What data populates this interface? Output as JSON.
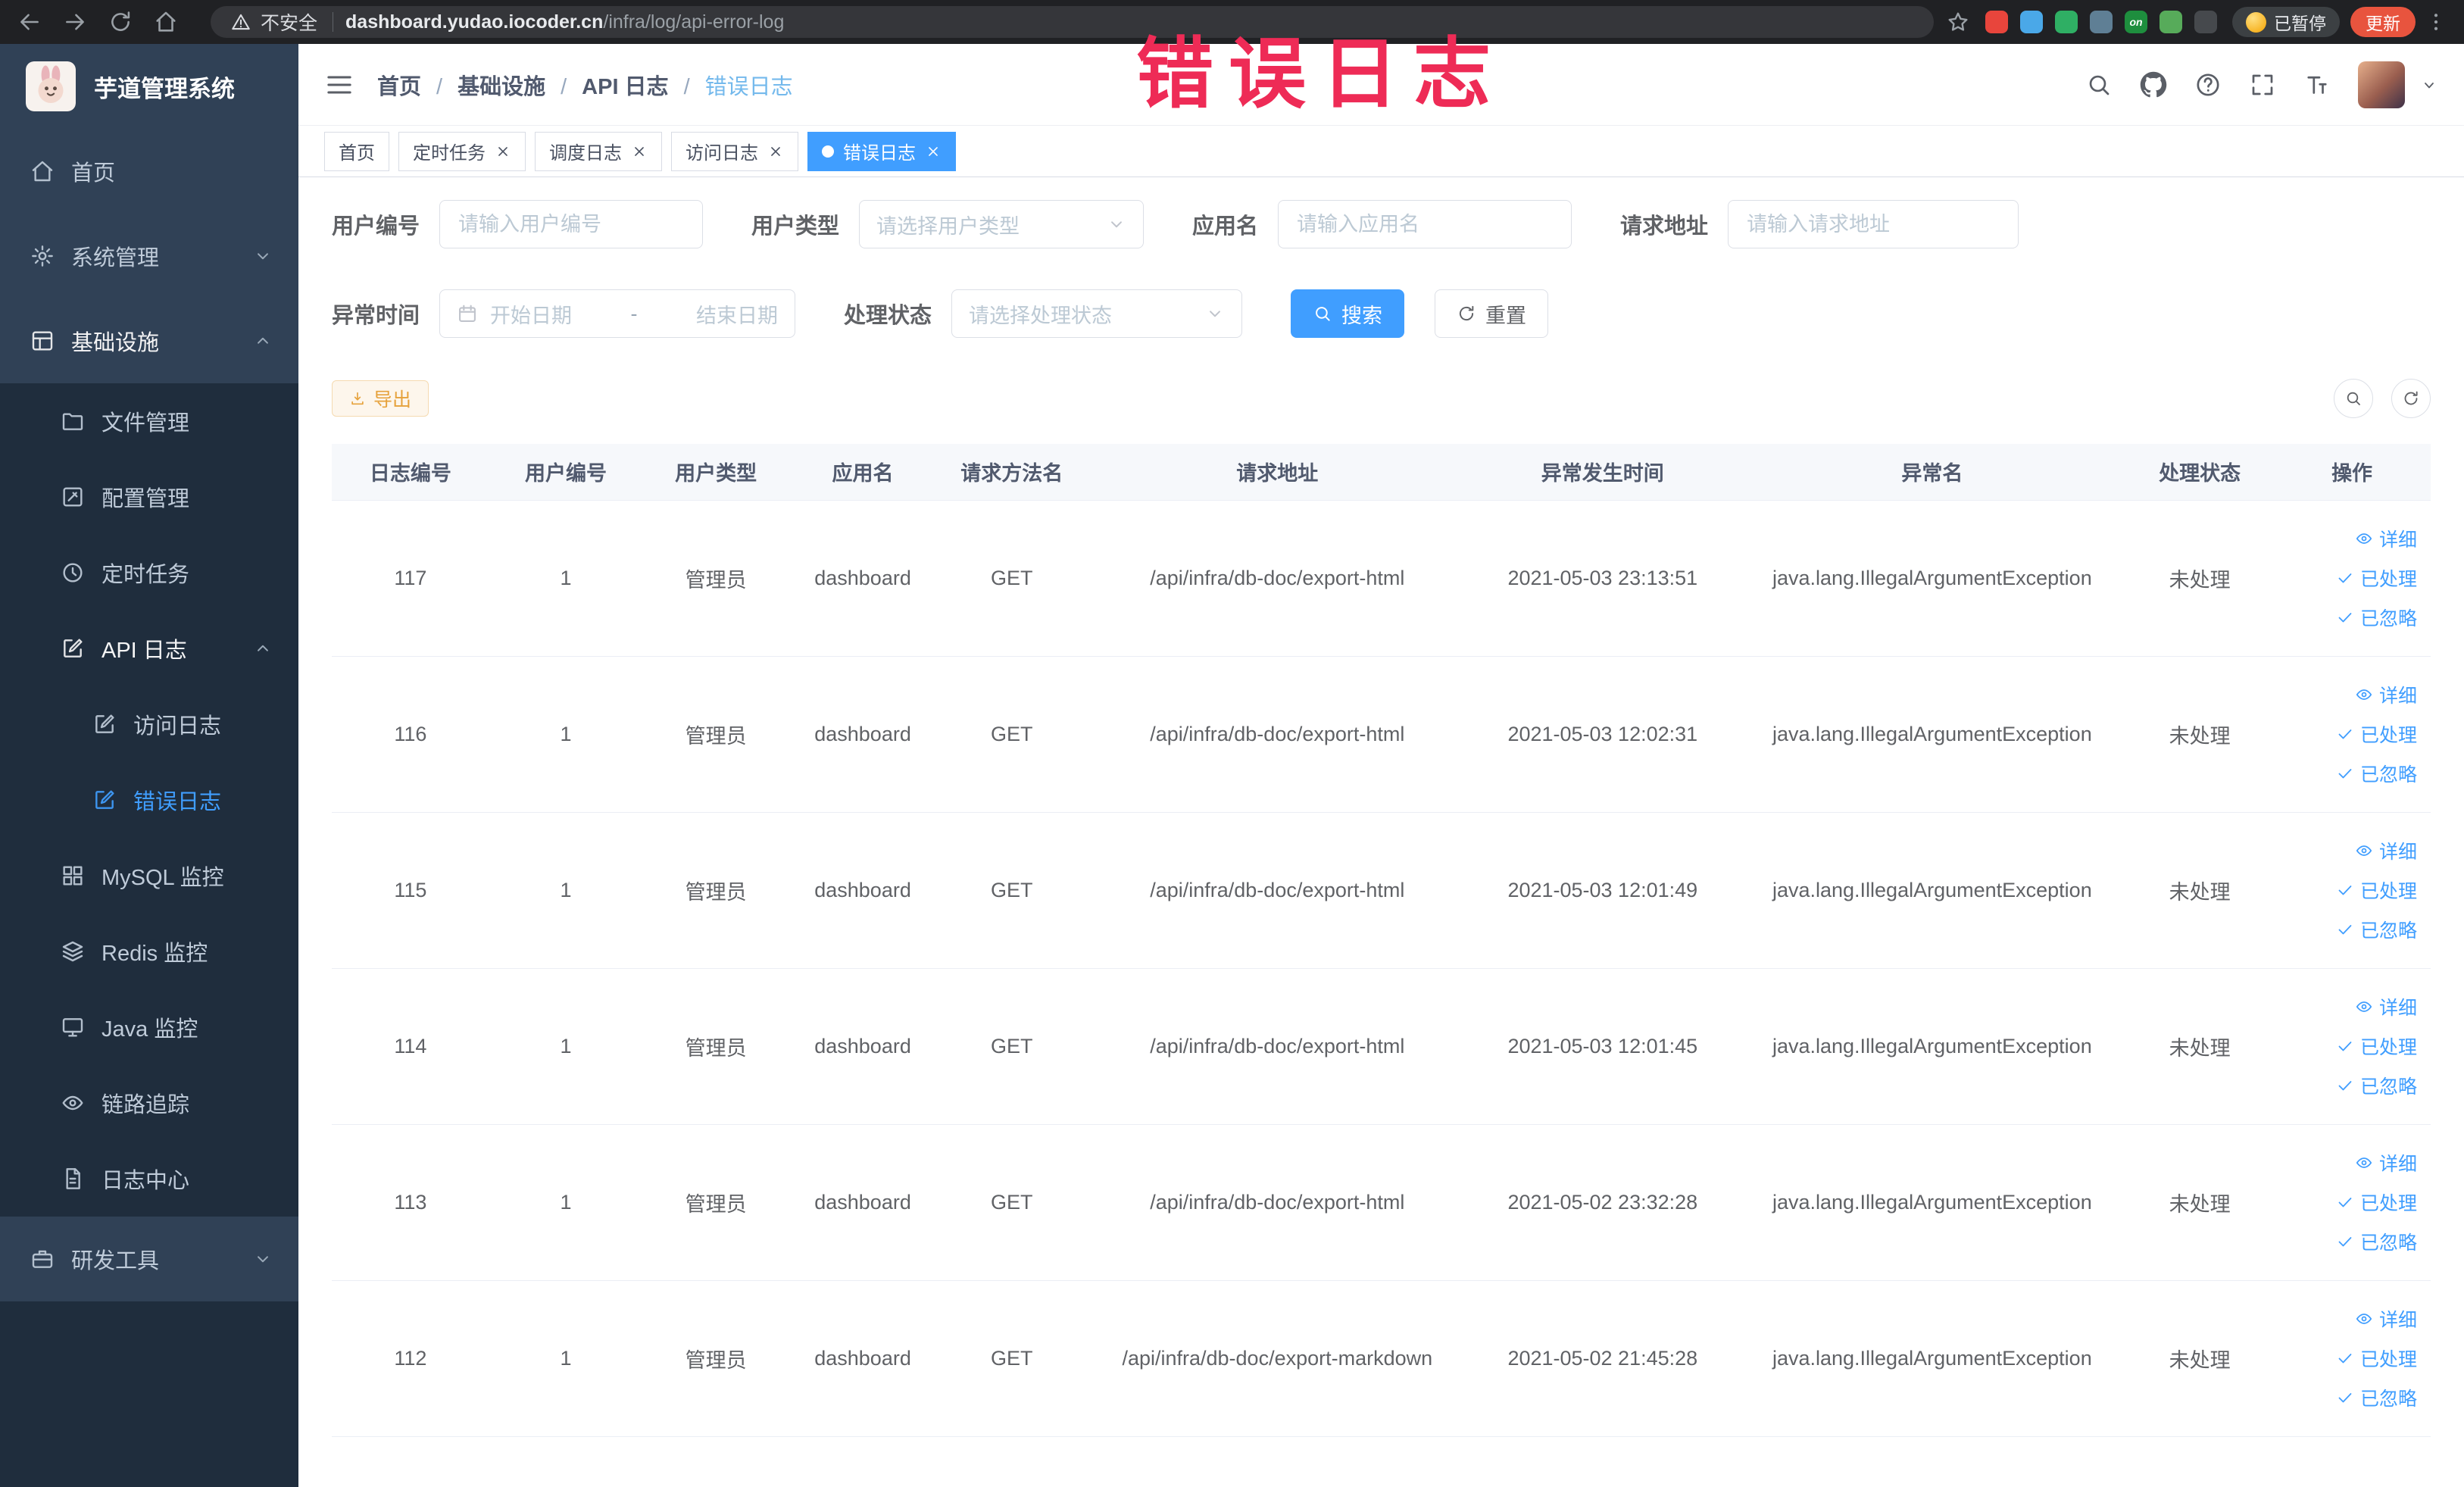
{
  "theme": {
    "accent": "#409eff",
    "sidebar_bg": "#304156",
    "submenu_bg": "#1f2d3d",
    "warning": "#e6a23c"
  },
  "annotation": {
    "text": "错误日志",
    "color": "#ee2b56"
  },
  "browser": {
    "security_label": "不安全",
    "url_host": "dashboard.yudao.iocoder.cn",
    "url_path": "/infra/log/api-error-log",
    "extensions": [
      {
        "name": "extension-red",
        "color": "#e8453c"
      },
      {
        "name": "extension-blue",
        "color": "#4aa8e8"
      },
      {
        "name": "extension-green",
        "color": "#2faf64"
      },
      {
        "name": "extension-slate",
        "color": "#5f7f95"
      },
      {
        "name": "extension-on-badge",
        "color": "#1e8e3e",
        "glyph": "on"
      },
      {
        "name": "extension-leaf",
        "color": "#57ab5a"
      },
      {
        "name": "extension-paw",
        "color": "#46494d"
      }
    ],
    "paused_badge_label": "已暂停",
    "update_button_label": "更新",
    "update_button_color": "#e8543e"
  },
  "sidebar": {
    "logo_title": "芋道管理系统",
    "menu": [
      {
        "label": "首页",
        "icon": "home-icon",
        "level": 0
      },
      {
        "label": "系统管理",
        "icon": "gear-icon",
        "level": 0,
        "arrow": "chevron-down-icon"
      },
      {
        "label": "基础设施",
        "icon": "infra-icon",
        "level": 0,
        "arrow": "chevron-up-icon",
        "open": true
      },
      {
        "label": "文件管理",
        "icon": "file-icon",
        "level": 1,
        "submenu": true
      },
      {
        "label": "配置管理",
        "icon": "config-icon",
        "level": 1,
        "submenu": true
      },
      {
        "label": "定时任务",
        "icon": "job-icon",
        "level": 1,
        "submenu": true
      },
      {
        "label": "API 日志",
        "icon": "log-icon",
        "level": 1,
        "submenu": true,
        "arrow": "chevron-up-icon",
        "open": true
      },
      {
        "label": "访问日志",
        "icon": "log-icon",
        "level": 2,
        "submenu": true
      },
      {
        "label": "错误日志",
        "icon": "log-icon",
        "level": 2,
        "submenu": true,
        "active": true
      },
      {
        "label": "MySQL 监控",
        "icon": "mysql-icon",
        "level": 1,
        "submenu": true
      },
      {
        "label": "Redis 监控",
        "icon": "redis-icon",
        "level": 1,
        "submenu": true
      },
      {
        "label": "Java 监控",
        "icon": "java-icon",
        "level": 1,
        "submenu": true
      },
      {
        "label": "链路追踪",
        "icon": "trace-icon",
        "level": 1,
        "submenu": true
      },
      {
        "label": "日志中心",
        "icon": "logcenter-icon",
        "level": 1,
        "submenu": true
      },
      {
        "label": "研发工具",
        "icon": "tool-icon",
        "level": 0,
        "arrow": "chevron-down-icon"
      }
    ]
  },
  "breadcrumb": [
    "首页",
    "基础设施",
    "API 日志",
    "错误日志"
  ],
  "tabs": [
    {
      "label": "首页",
      "closable": false
    },
    {
      "label": "定时任务",
      "closable": true
    },
    {
      "label": "调度日志",
      "closable": true
    },
    {
      "label": "访问日志",
      "closable": true
    },
    {
      "label": "错误日志",
      "closable": true,
      "active": true
    }
  ],
  "filters": {
    "user_id_label": "用户编号",
    "user_id_placeholder": "请输入用户编号",
    "user_type_label": "用户类型",
    "user_type_placeholder": "请选择用户类型",
    "app_name_label": "应用名",
    "app_name_placeholder": "请输入应用名",
    "request_url_label": "请求地址",
    "request_url_placeholder": "请输入请求地址",
    "exception_time_label": "异常时间",
    "start_date_placeholder": "开始日期",
    "date_separator": "-",
    "end_date_placeholder": "结束日期",
    "process_status_label": "处理状态",
    "process_status_placeholder": "请选择处理状态",
    "search_label": "搜索",
    "reset_label": "重置"
  },
  "toolbar": {
    "export_label": "导出"
  },
  "table": {
    "headers": [
      "日志编号",
      "用户编号",
      "用户类型",
      "应用名",
      "请求方法名",
      "请求地址",
      "异常发生时间",
      "异常名",
      "处理状态",
      "操作"
    ],
    "action_labels": {
      "detail": "详细",
      "processed": "已处理",
      "ignored": "已忽略"
    },
    "rows": [
      {
        "log_id": "117",
        "user_id": "1",
        "user_type": "管理员",
        "app_name": "dashboard",
        "method": "GET",
        "url": "/api/infra/db-doc/export-html",
        "time": "2021-05-03 23:13:51",
        "exception": "java.lang.IllegalArgumentException",
        "status": "未处理"
      },
      {
        "log_id": "116",
        "user_id": "1",
        "user_type": "管理员",
        "app_name": "dashboard",
        "method": "GET",
        "url": "/api/infra/db-doc/export-html",
        "time": "2021-05-03 12:02:31",
        "exception": "java.lang.IllegalArgumentException",
        "status": "未处理"
      },
      {
        "log_id": "115",
        "user_id": "1",
        "user_type": "管理员",
        "app_name": "dashboard",
        "method": "GET",
        "url": "/api/infra/db-doc/export-html",
        "time": "2021-05-03 12:01:49",
        "exception": "java.lang.IllegalArgumentException",
        "status": "未处理"
      },
      {
        "log_id": "114",
        "user_id": "1",
        "user_type": "管理员",
        "app_name": "dashboard",
        "method": "GET",
        "url": "/api/infra/db-doc/export-html",
        "time": "2021-05-03 12:01:45",
        "exception": "java.lang.IllegalArgumentException",
        "status": "未处理"
      },
      {
        "log_id": "113",
        "user_id": "1",
        "user_type": "管理员",
        "app_name": "dashboard",
        "method": "GET",
        "url": "/api/infra/db-doc/export-html",
        "time": "2021-05-02 23:32:28",
        "exception": "java.lang.IllegalArgumentException",
        "status": "未处理"
      },
      {
        "log_id": "112",
        "user_id": "1",
        "user_type": "管理员",
        "app_name": "dashboard",
        "method": "GET",
        "url": "/api/infra/db-doc/export-markdown",
        "time": "2021-05-02 21:45:28",
        "exception": "java.lang.IllegalArgumentException",
        "status": "未处理"
      }
    ]
  }
}
